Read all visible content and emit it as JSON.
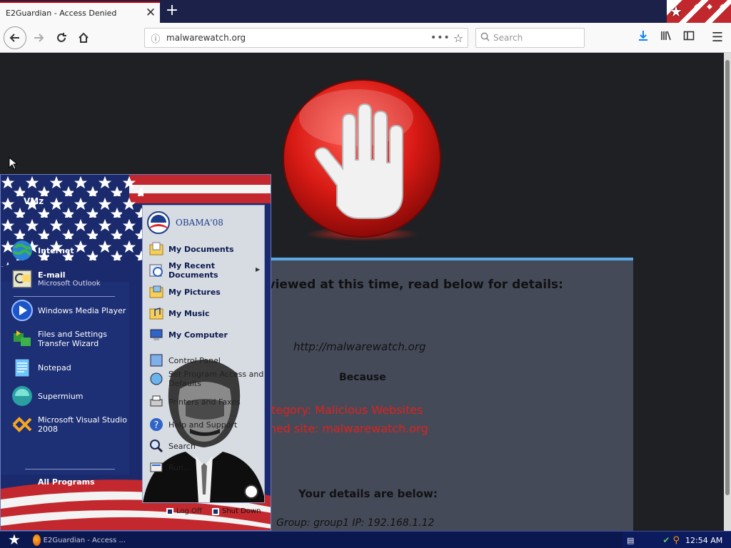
{
  "browser": {
    "tab_title": "E2Guardian - Access Denied",
    "tab_close": "✕",
    "new_tab": "+",
    "url": "malwarewatch.org",
    "search_placeholder": "Search",
    "menu_icon": "☰"
  },
  "block_page": {
    "heading": "e viewed at this time, read below for details:",
    "blocked_url": "http://malwarewatch.org",
    "because_label": "Because",
    "category_line": "ategory: Malicious Websites",
    "matched_line": "ched site: malwarewatch.org",
    "details_heading": "Your details are below:",
    "group_line": "Group: group1   IP: 192.168.1.12"
  },
  "start_menu": {
    "user": "VMz",
    "pinned": [
      {
        "label": "Internet",
        "sub": ""
      },
      {
        "label": "E-mail",
        "sub": "Microsoft Outlook"
      }
    ],
    "recent": [
      {
        "label": "Windows Media Player"
      },
      {
        "label": "Files and Settings",
        "label2": "Transfer Wizard"
      },
      {
        "label": "Notepad"
      },
      {
        "label": "Supermium"
      },
      {
        "label": "Microsoft Visual Studio",
        "label2": "2008"
      }
    ],
    "all_programs": "All Programs",
    "logo_text": "OBAMA'08",
    "right": {
      "my_documents": "My Documents",
      "my_recent": "My Recent",
      "my_recent2": "Documents",
      "my_pictures": "My Pictures",
      "my_music": "My Music",
      "my_computer": "My Computer",
      "control_panel": "Control Panel",
      "spa": "Set Program Access and",
      "spa2": "Defaults",
      "printers": "Printers and Faxes",
      "help": "Help and Support",
      "search": "Search",
      "run": "Run..."
    },
    "log_off": "Log Off",
    "shut_down": "Shut Down"
  },
  "taskbar": {
    "task_label": "E2Guardian - Access ...",
    "clock": "12:54 AM"
  },
  "colors": {
    "accent_red": "#e0211b",
    "panel_bg": "#454a59",
    "panel_border": "#5aa9e6"
  }
}
